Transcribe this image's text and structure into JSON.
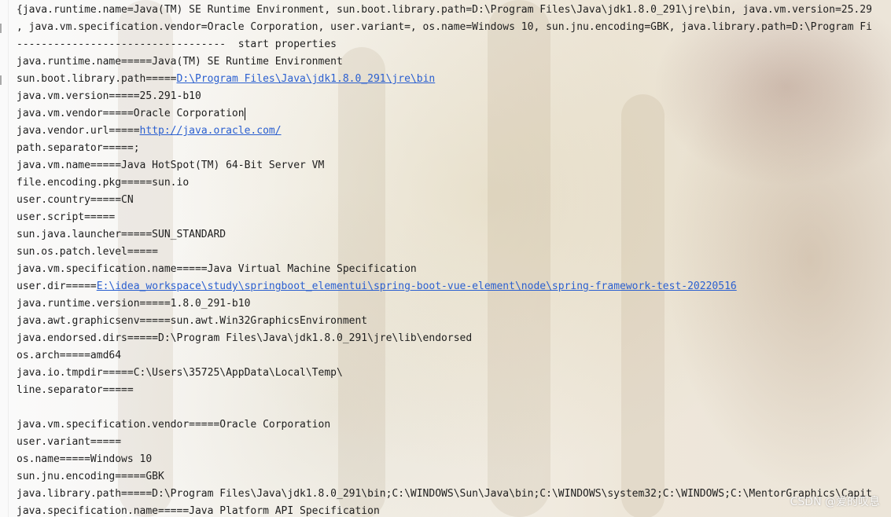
{
  "console": {
    "lines": [
      {
        "text": "{java.runtime.name=Java(TM) SE Runtime Environment, sun.boot.library.path=D:\\Program Files\\Java\\jdk1.8.0_291\\jre\\bin, java.vm.version=25.29"
      },
      {
        "text": ", java.vm.specification.vendor=Oracle Corporation, user.variant=, os.name=Windows 10, sun.jnu.encoding=GBK, java.library.path=D:\\Program Fi"
      },
      {
        "text": "----------------------------------  start properties"
      },
      {
        "text": "java.runtime.name=====Java(TM) SE Runtime Environment"
      },
      {
        "key": "sun.boot.library.path=====",
        "link": "D:\\Program Files\\Java\\jdk1.8.0_291\\jre\\bin"
      },
      {
        "text": "java.vm.version=====25.291-b10"
      },
      {
        "text": "java.vm.vendor=====Oracle Corporation",
        "caret": true
      },
      {
        "key": "java.vendor.url=====",
        "link": "http://java.oracle.com/"
      },
      {
        "text": "path.separator=====;"
      },
      {
        "text": "java.vm.name=====Java HotSpot(TM) 64-Bit Server VM"
      },
      {
        "text": "file.encoding.pkg=====sun.io"
      },
      {
        "text": "user.country=====CN"
      },
      {
        "text": "user.script====="
      },
      {
        "text": "sun.java.launcher=====SUN_STANDARD"
      },
      {
        "text": "sun.os.patch.level====="
      },
      {
        "text": "java.vm.specification.name=====Java Virtual Machine Specification"
      },
      {
        "key": "user.dir=====",
        "link": "E:\\idea_workspace\\study\\springboot_elementui\\spring-boot-vue-element\\node\\spring-framework-test-20220516"
      },
      {
        "text": "java.runtime.version=====1.8.0_291-b10"
      },
      {
        "text": "java.awt.graphicsenv=====sun.awt.Win32GraphicsEnvironment"
      },
      {
        "text": "java.endorsed.dirs=====D:\\Program Files\\Java\\jdk1.8.0_291\\jre\\lib\\endorsed"
      },
      {
        "text": "os.arch=====amd64"
      },
      {
        "text": "java.io.tmpdir=====C:\\Users\\35725\\AppData\\Local\\Temp\\"
      },
      {
        "text": "line.separator====="
      },
      {
        "text": ""
      },
      {
        "text": "java.vm.specification.vendor=====Oracle Corporation"
      },
      {
        "text": "user.variant====="
      },
      {
        "text": "os.name=====Windows 10"
      },
      {
        "text": "sun.jnu.encoding=====GBK"
      },
      {
        "text": "java.library.path=====D:\\Program Files\\Java\\jdk1.8.0_291\\bin;C:\\WINDOWS\\Sun\\Java\\bin;C:\\WINDOWS\\system32;C:\\WINDOWS;C:\\MentorGraphics\\Capit"
      },
      {
        "text": "java.specification.name=====Java Platform API Specification"
      }
    ]
  },
  "watermark": "CSDN @爱的叹息",
  "colors": {
    "text": "#1e1e1e",
    "link": "#2a5fd0"
  }
}
